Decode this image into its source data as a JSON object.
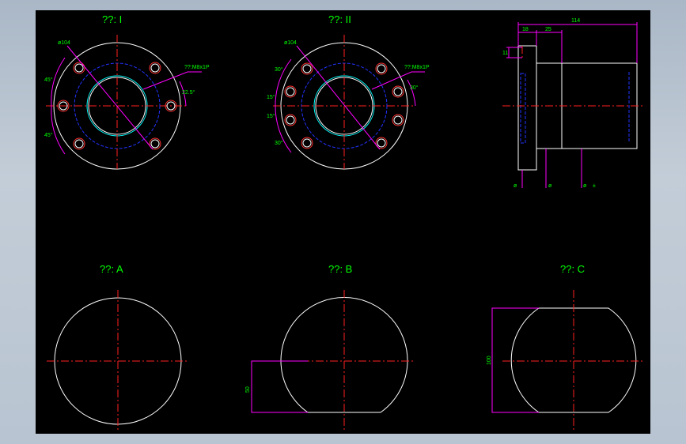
{
  "views": {
    "flange_1": {
      "title": "??: I",
      "dia_label": "ø104",
      "thread_label": "??:M8x1P",
      "angle_a": "45°",
      "angle_b": "45°",
      "angle_c": "22.5°"
    },
    "flange_2": {
      "title": "??: II",
      "dia_label": "ø104",
      "thread_label": "??:M8x1P",
      "angle_a": "30°",
      "angle_b": "15°",
      "angle_c": "15°",
      "angle_d": "30°",
      "angle_e": "30°"
    },
    "side": {
      "dim_total": "114",
      "dim_flange": "18",
      "dim_step": "25",
      "dim_height": "11",
      "dim_d1": "ø",
      "dim_d2": "ø",
      "dim_d3": "ø",
      "dim_d3_suffix": "±"
    },
    "section_a": {
      "title": "??: A"
    },
    "section_b": {
      "title": "??: B",
      "dim_flat": "50"
    },
    "section_c": {
      "title": "??: C",
      "dim_width": "100"
    }
  },
  "colors": {
    "background": "#000000",
    "outline": "#ffffff",
    "center_line": "#ff2020",
    "dimension": "#ff00ff",
    "text": "#00ff00",
    "hidden": "#2233ff",
    "thread": "#00ffff"
  }
}
